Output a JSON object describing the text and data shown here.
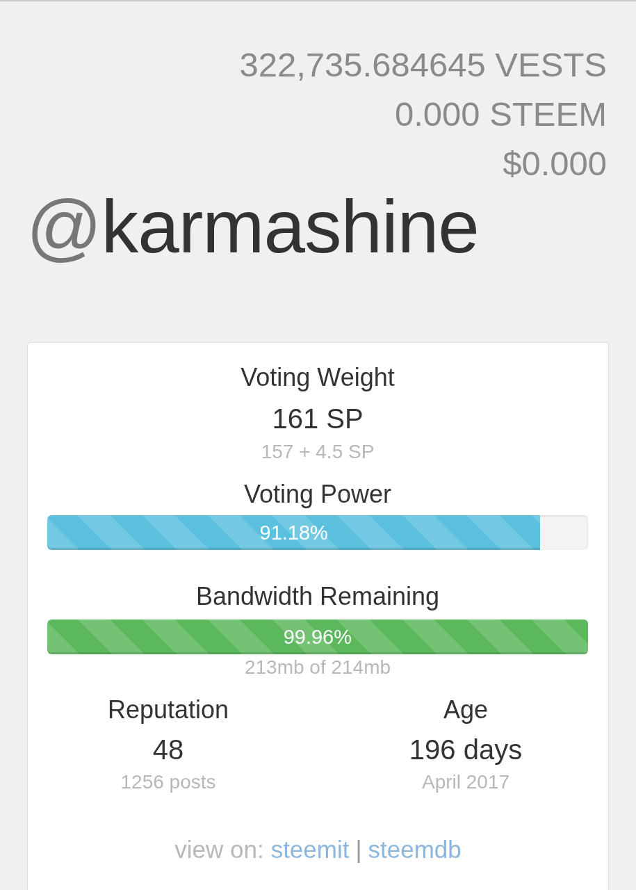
{
  "balances": [
    "322,735.684645 VESTS",
    "0.000 STEEM",
    "$0.000"
  ],
  "account": {
    "prefix": "@",
    "name": "karmashine"
  },
  "card": {
    "voting_weight": {
      "label": "Voting Weight",
      "value": "161 SP",
      "detail": "157 + 4.5 SP"
    },
    "meters": [
      {
        "label": "Voting Power",
        "level": 0.9118,
        "reading": "91.18%",
        "color": "#5bc0de"
      },
      {
        "label": "Bandwidth Remaining",
        "level": 0.9996,
        "reading": "99.96%",
        "color": "#5cb85c",
        "detail": "213mb of 214mb"
      }
    ],
    "stats": [
      {
        "label": "Reputation",
        "value": "48",
        "detail": "1256 posts"
      },
      {
        "label": "Age",
        "value": "196 days",
        "detail": "April 2017"
      }
    ],
    "links": {
      "prefix": "view on:",
      "items": [
        "steemit",
        "steemdb"
      ],
      "separator": "|"
    }
  }
}
